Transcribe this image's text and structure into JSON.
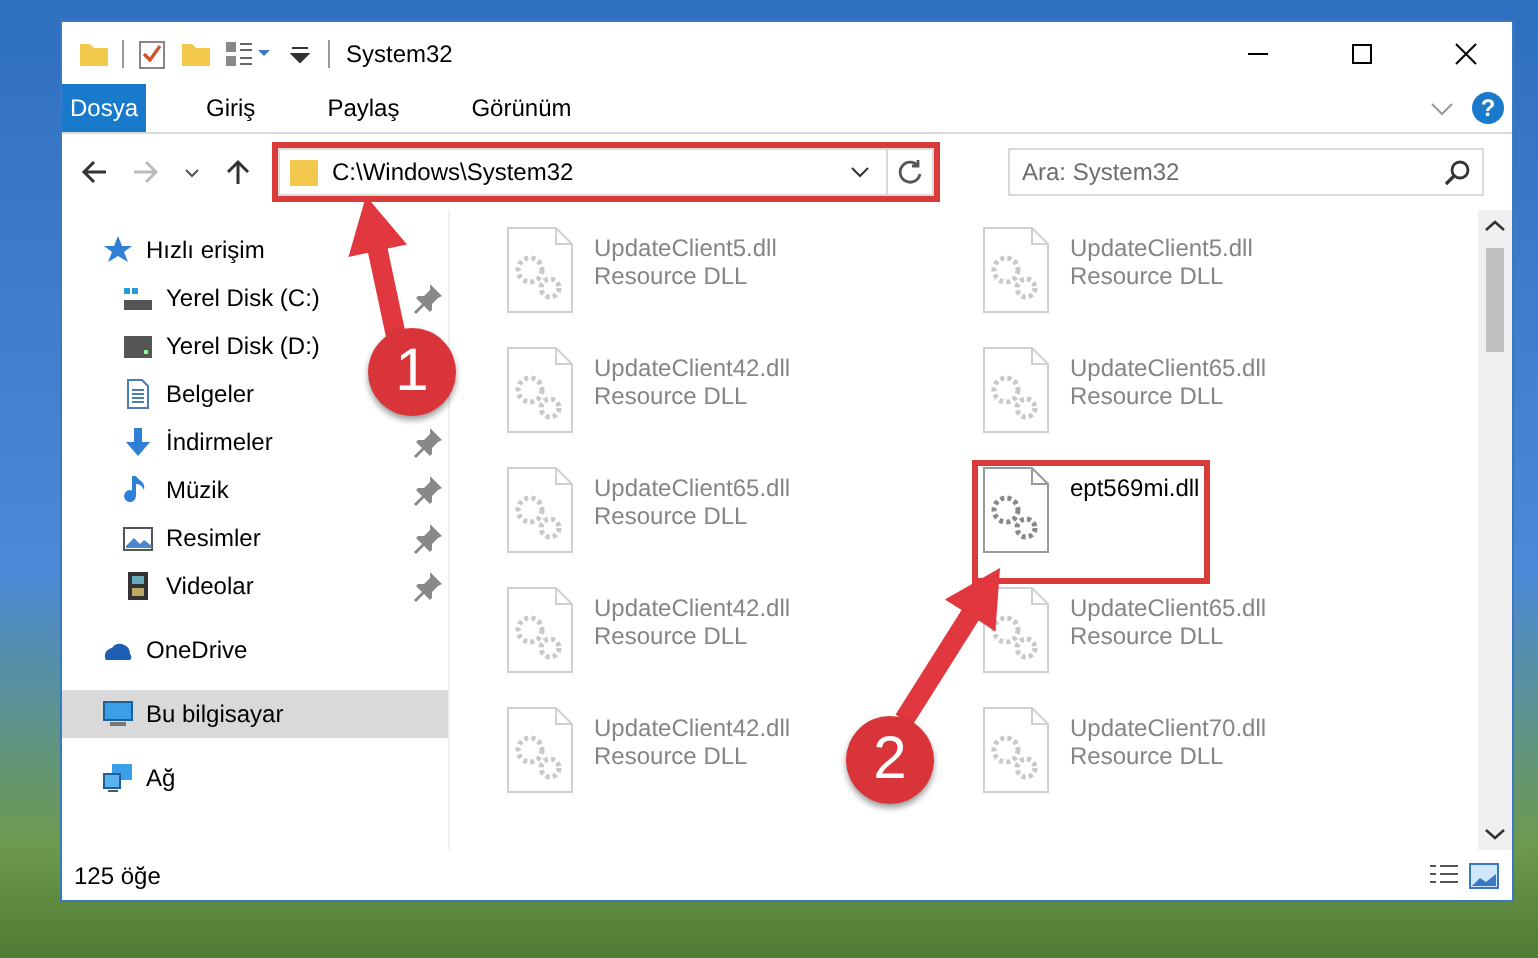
{
  "window": {
    "title": "System32"
  },
  "ribbon": {
    "tabs": [
      {
        "label": "Dosya",
        "kind": "file",
        "selected": false
      },
      {
        "label": "Giriş",
        "kind": "tab",
        "selected": false
      },
      {
        "label": "Paylaş",
        "kind": "tab",
        "selected": false
      },
      {
        "label": "Görünüm",
        "kind": "tab",
        "selected": false
      }
    ],
    "help": "?"
  },
  "address": {
    "path": "C:\\Windows\\System32",
    "highlighted": true
  },
  "search": {
    "placeholder": "Ara: System32"
  },
  "sidebar": {
    "items": [
      {
        "label": "Hızlı erişim",
        "selected": false,
        "children": [
          {
            "label": "Yerel Disk (C:)",
            "pinned": true,
            "selected": false
          },
          {
            "label": "Yerel Disk (D:)",
            "pinned": false,
            "selected": false
          },
          {
            "label": "Belgeler",
            "pinned": false,
            "selected": false
          },
          {
            "label": "İndirmeler",
            "pinned": true,
            "selected": false
          },
          {
            "label": "Müzik",
            "pinned": true,
            "selected": false
          },
          {
            "label": "Resimler",
            "pinned": true,
            "selected": false
          },
          {
            "label": "Videolar",
            "pinned": true,
            "selected": false
          }
        ]
      },
      {
        "label": "OneDrive",
        "selected": false
      },
      {
        "label": "Bu bilgisayar",
        "selected": true
      },
      {
        "label": "Ağ",
        "selected": false
      }
    ]
  },
  "files": [
    {
      "name": "UpdateClient5.dll",
      "type": "Resource DLL",
      "faded": true,
      "highlighted": false
    },
    {
      "name": "UpdateClient5.dll",
      "type": "Resource DLL",
      "faded": true,
      "highlighted": false
    },
    {
      "name": "UpdateClient42.dll",
      "type": "Resource DLL",
      "faded": true,
      "highlighted": false
    },
    {
      "name": "UpdateClient65.dll",
      "type": "Resource DLL",
      "faded": true,
      "highlighted": false
    },
    {
      "name": "UpdateClient65.dll",
      "type": "Resource DLL",
      "faded": true,
      "highlighted": false
    },
    {
      "name": "ept569mi.dll",
      "faded": false,
      "highlighted": true
    },
    {
      "name": "UpdateClient42.dll",
      "type": "Resource DLL",
      "faded": true,
      "highlighted": false
    },
    {
      "name": "UpdateClient65.dll",
      "type": "Resource DLL",
      "faded": true,
      "highlighted": false
    },
    {
      "name": "UpdateClient42.dll",
      "type": "Resource DLL",
      "faded": true,
      "highlighted": false
    },
    {
      "name": "UpdateClient70.dll",
      "type": "Resource DLL",
      "faded": true,
      "highlighted": false
    }
  ],
  "status_bar": {
    "count": "125 öğe"
  },
  "annotations": [
    {
      "label": "1"
    },
    {
      "label": "2"
    }
  ]
}
